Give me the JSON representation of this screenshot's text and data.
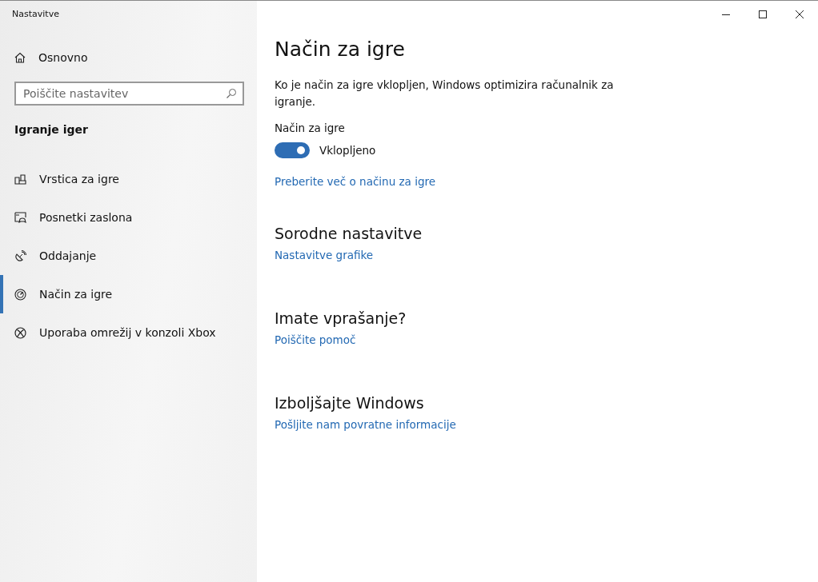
{
  "window": {
    "title": "Nastavitve"
  },
  "sidebar": {
    "home": "Osnovno",
    "search": {
      "placeholder": "Poiščite nastavitev"
    },
    "section_title": "Igranje iger",
    "items": [
      {
        "label": "Vrstica za igre",
        "selected": false
      },
      {
        "label": "Posnetki zaslona",
        "selected": false
      },
      {
        "label": "Oddajanje",
        "selected": false
      },
      {
        "label": "Način za igre",
        "selected": true
      },
      {
        "label": "Uporaba omrežij v konzoli Xbox",
        "selected": false
      }
    ]
  },
  "page": {
    "title": "Način za igre",
    "description": "Ko je način za igre vklopljen, Windows optimizira računalnik za igranje.",
    "toggle": {
      "label": "Način za igre",
      "on": true,
      "state_text": "Vklopljeno"
    },
    "link": "Preberite več o načinu za igre",
    "sections": [
      {
        "heading": "Sorodne nastavitve",
        "link": "Nastavitve grafike"
      },
      {
        "heading": "Imate vprašanje?",
        "link": "Poiščite pomoč"
      },
      {
        "heading": "Izboljšajte Windows",
        "link": "Pošljite nam povratne informacije"
      }
    ]
  }
}
